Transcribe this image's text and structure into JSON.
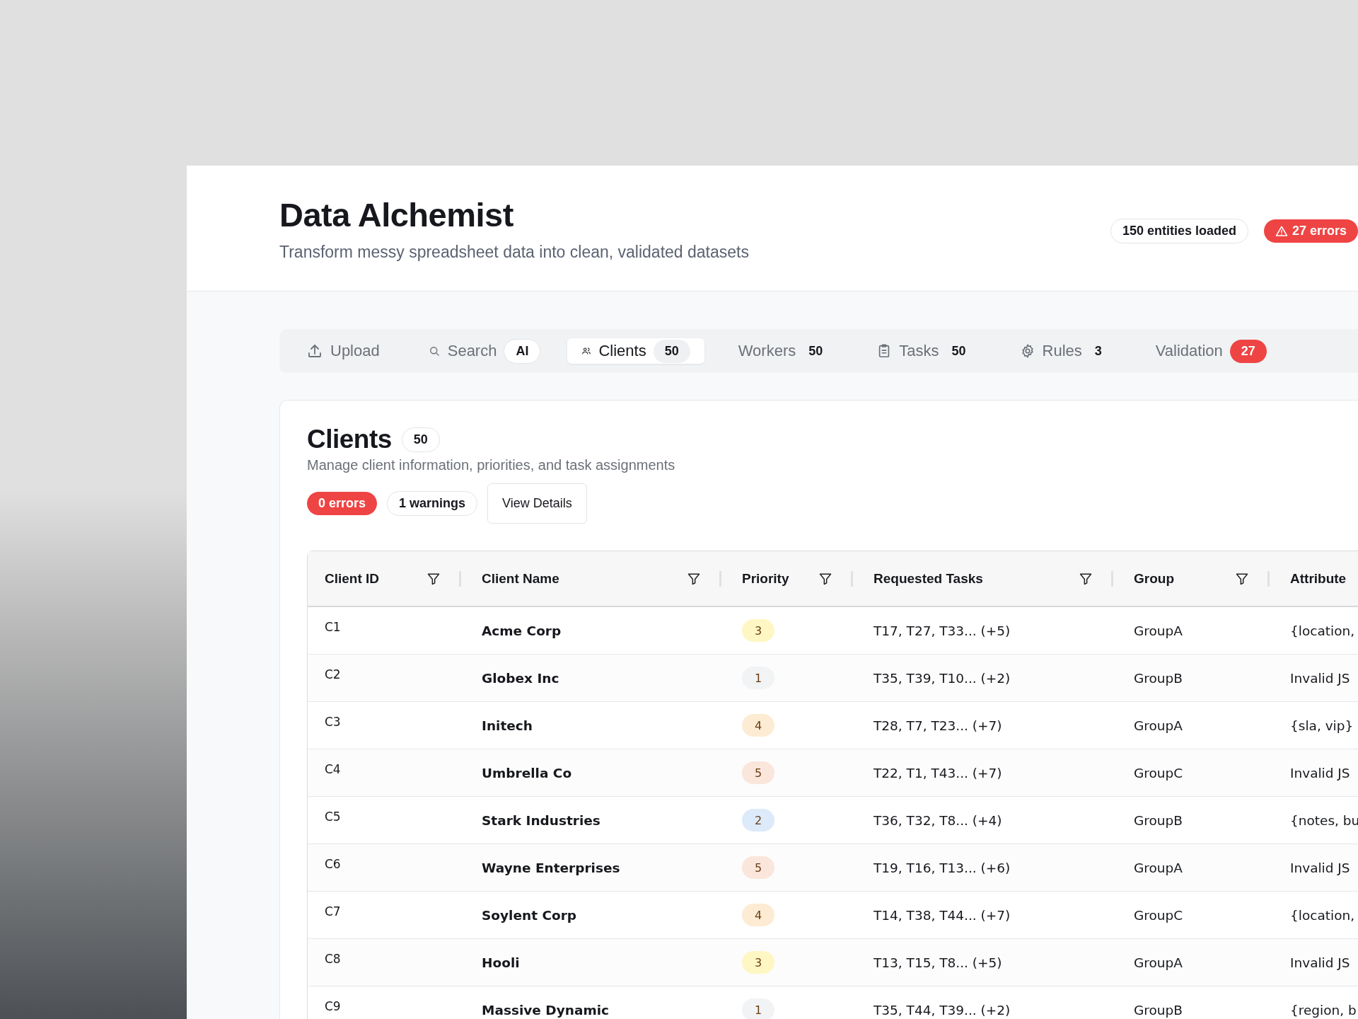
{
  "header": {
    "title": "Data Alchemist",
    "subtitle": "Transform messy spreadsheet data into clean, validated datasets",
    "badges": [
      {
        "text": "150 entities loaded",
        "kind": "outline"
      },
      {
        "text": "27 errors",
        "kind": "danger"
      }
    ]
  },
  "tabs": [
    {
      "label": "Upload",
      "kind": "upload",
      "selected": false
    },
    {
      "label": "Search",
      "kind": "search",
      "selected": false,
      "badge": {
        "text": "AI",
        "kind": "outline"
      }
    },
    {
      "label": "Clients",
      "kind": "users",
      "selected": true,
      "badge": {
        "text": "50",
        "kind": "muted"
      }
    },
    {
      "label": "Workers",
      "kind": "plain",
      "selected": false,
      "badge": {
        "text": "50",
        "kind": "plain"
      }
    },
    {
      "label": "Tasks",
      "kind": "clipboard",
      "selected": false,
      "badge": {
        "text": "50",
        "kind": "plain"
      }
    },
    {
      "label": "Rules",
      "kind": "gear",
      "selected": false,
      "badge": {
        "text": "3",
        "kind": "plain"
      }
    },
    {
      "label": "Validation",
      "kind": "plain",
      "selected": false,
      "badge": {
        "text": "27",
        "kind": "danger"
      }
    }
  ],
  "section": {
    "title": "Clients",
    "count": "50",
    "subtitle": "Manage client information, priorities, and task assignments",
    "badges": [
      {
        "text": "0 errors",
        "kind": "danger"
      },
      {
        "text": "1 warnings",
        "kind": "outline"
      }
    ],
    "button": "View Details"
  },
  "table": {
    "columns": [
      "Client ID",
      "Client Name",
      "Priority",
      "Requested Tasks",
      "Group",
      "Attribute"
    ],
    "rows": [
      {
        "id": "C1",
        "name": "Acme Corp",
        "priority": {
          "text": "3",
          "color": "#fef7c3"
        },
        "tasks": "T17, T27, T33... (+5)",
        "group": "GroupA",
        "attributes": "{location,"
      },
      {
        "id": "C2",
        "name": "Globex Inc",
        "priority": {
          "text": "1",
          "color": "#f1f3f5"
        },
        "tasks": "T35, T39, T10... (+2)",
        "group": "GroupB",
        "attributes": "Invalid JS"
      },
      {
        "id": "C3",
        "name": "Initech",
        "priority": {
          "text": "4",
          "color": "#fdebd3"
        },
        "tasks": "T28, T7, T23... (+7)",
        "group": "GroupA",
        "attributes": "{sla, vip}"
      },
      {
        "id": "C4",
        "name": "Umbrella Co",
        "priority": {
          "text": "5",
          "color": "#fbe6dc"
        },
        "tasks": "T22, T1, T43... (+7)",
        "group": "GroupC",
        "attributes": "Invalid JS"
      },
      {
        "id": "C5",
        "name": "Stark Industries",
        "priority": {
          "text": "2",
          "color": "#dceafa"
        },
        "tasks": "T36, T32, T8... (+4)",
        "group": "GroupB",
        "attributes": "{notes, bu"
      },
      {
        "id": "C6",
        "name": "Wayne Enterprises",
        "priority": {
          "text": "5",
          "color": "#fbe6dc"
        },
        "tasks": "T19, T16, T13... (+6)",
        "group": "GroupA",
        "attributes": "Invalid JS"
      },
      {
        "id": "C7",
        "name": "Soylent Corp",
        "priority": {
          "text": "4",
          "color": "#fdebd3"
        },
        "tasks": "T14, T38, T44... (+7)",
        "group": "GroupC",
        "attributes": "{location,"
      },
      {
        "id": "C8",
        "name": "Hooli",
        "priority": {
          "text": "3",
          "color": "#fef7c3"
        },
        "tasks": "T13, T15, T8... (+5)",
        "group": "GroupA",
        "attributes": "Invalid JS"
      },
      {
        "id": "C9",
        "name": "Massive Dynamic",
        "priority": {
          "text": "1",
          "color": "#f1f3f5"
        },
        "tasks": "T35, T44, T39... (+2)",
        "group": "GroupB",
        "attributes": "{region, b"
      }
    ]
  }
}
